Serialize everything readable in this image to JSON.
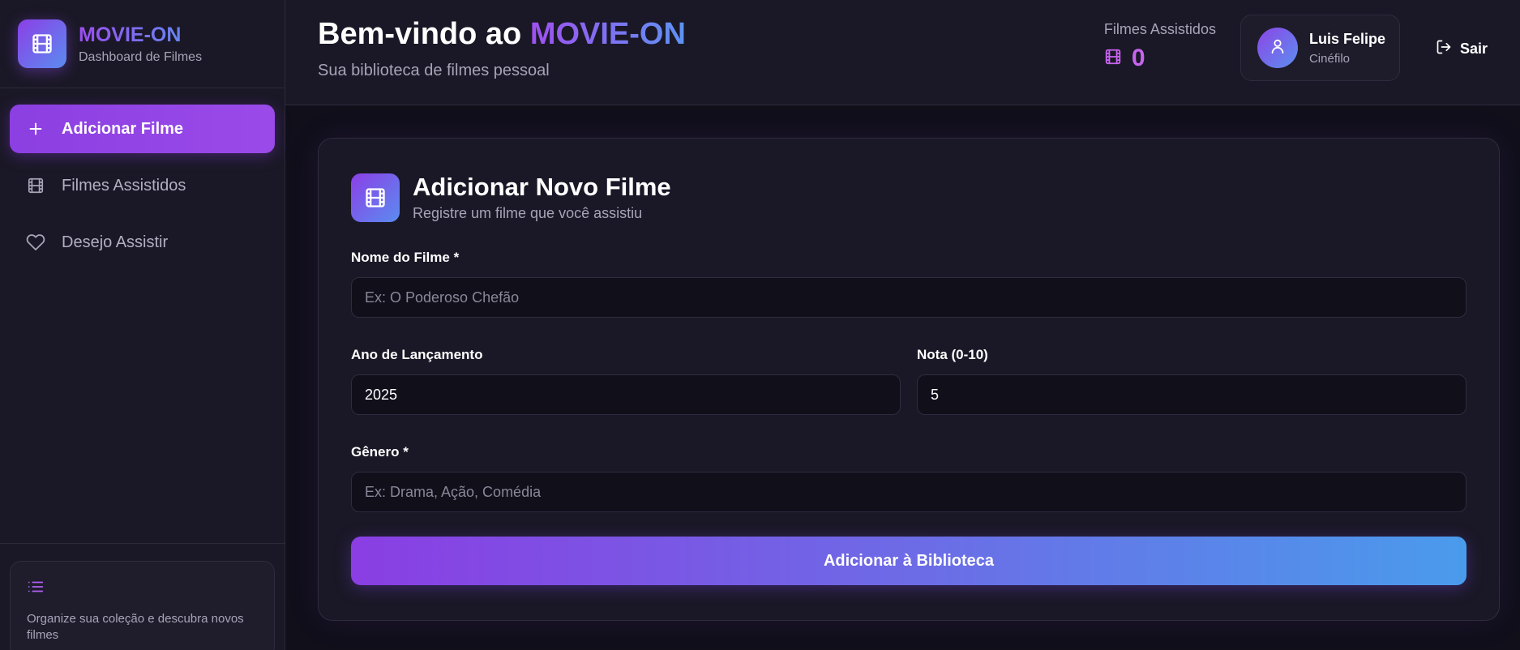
{
  "brand": {
    "name": "MOVIE-ON",
    "subtitle": "Dashboard de Filmes",
    "icon": "film-icon"
  },
  "sidebar": {
    "items": [
      {
        "label": "Adicionar Filme",
        "icon": "plus-icon",
        "active": true
      },
      {
        "label": "Filmes Assistidos",
        "icon": "film-icon",
        "active": false
      },
      {
        "label": "Desejo Assistir",
        "icon": "heart-icon",
        "active": false
      }
    ],
    "footer": {
      "icon": "list-icon",
      "text": "Organize sua coleção e descubra novos filmes"
    }
  },
  "header": {
    "welcome_prefix": "Bem-vindo ao ",
    "welcome_brand": "MOVIE-ON",
    "subtitle": "Sua biblioteca de filmes pessoal",
    "stat_label": "Filmes Assistidos",
    "stat_value": "0",
    "user": {
      "name": "Luis Felipe",
      "role": "Cinéfilo",
      "icon": "user-icon"
    },
    "logout_label": "Sair"
  },
  "form": {
    "title": "Adicionar Novo Filme",
    "subtitle": "Registre um filme que você assistiu",
    "name_label": "Nome do Filme *",
    "name_placeholder": "Ex: O Poderoso Chefão",
    "year_label": "Ano de Lançamento",
    "year_value": "2025",
    "rating_label": "Nota (0-10)",
    "rating_value": "5",
    "genre_label": "Gênero *",
    "genre_placeholder": "Ex: Drama, Ação, Comédia",
    "submit_label": "Adicionar à Biblioteca"
  },
  "colors": {
    "background": "#100f1a",
    "panel": "#1a1826",
    "accent_purple": "#8c3fe2",
    "accent_blue": "#4a9bec",
    "stat_color": "#c864f0"
  }
}
